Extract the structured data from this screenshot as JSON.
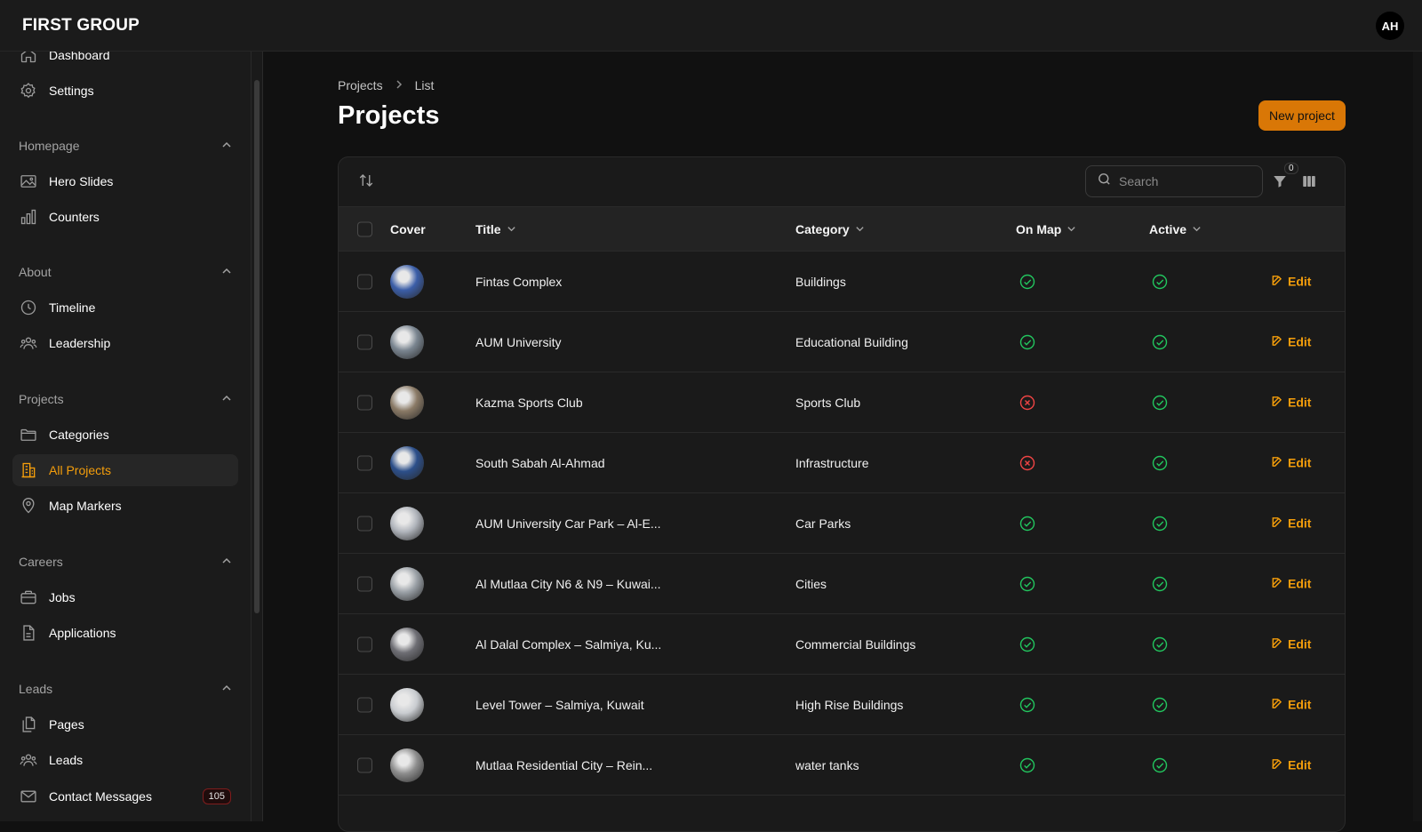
{
  "app": {
    "brand": "FIRST GROUP",
    "user_initials": "AH"
  },
  "sidebar": {
    "top_items": [
      {
        "label": "Dashboard",
        "icon": "home-icon"
      },
      {
        "label": "Settings",
        "icon": "gear-icon"
      }
    ],
    "groups": [
      {
        "label": "Homepage",
        "items": [
          {
            "label": "Hero Slides",
            "icon": "image-icon"
          },
          {
            "label": "Counters",
            "icon": "bar-chart-icon"
          }
        ]
      },
      {
        "label": "About",
        "items": [
          {
            "label": "Timeline",
            "icon": "clock-icon"
          },
          {
            "label": "Leadership",
            "icon": "users-icon"
          }
        ]
      },
      {
        "label": "Projects",
        "items": [
          {
            "label": "Categories",
            "icon": "folder-icon"
          },
          {
            "label": "All Projects",
            "icon": "building-icon",
            "active": true
          },
          {
            "label": "Map Markers",
            "icon": "map-pin-icon"
          }
        ]
      },
      {
        "label": "Careers",
        "items": [
          {
            "label": "Jobs",
            "icon": "briefcase-icon"
          },
          {
            "label": "Applications",
            "icon": "document-icon"
          }
        ]
      },
      {
        "label": "Leads",
        "items": [
          {
            "label": "Pages",
            "icon": "pages-icon"
          },
          {
            "label": "Leads",
            "icon": "users-icon"
          },
          {
            "label": "Contact Messages",
            "icon": "mail-icon",
            "badge": "105"
          }
        ]
      }
    ]
  },
  "breadcrumb": {
    "parent": "Projects",
    "current": "List"
  },
  "page": {
    "title": "Projects",
    "new_button": "New project"
  },
  "toolbar": {
    "search_placeholder": "Search",
    "filter_count": "0"
  },
  "table": {
    "columns": {
      "cover": "Cover",
      "title": "Title",
      "category": "Category",
      "on_map": "On Map",
      "active": "Active"
    },
    "edit_label": "Edit",
    "rows": [
      {
        "title": "Fintas Complex",
        "category": "Buildings",
        "on_map": true,
        "active": true,
        "thumb_color": "#3b5ea8"
      },
      {
        "title": "AUM University",
        "category": "Educational Building",
        "on_map": true,
        "active": true,
        "thumb_color": "#7a8590"
      },
      {
        "title": "Kazma Sports Club",
        "category": "Sports Club",
        "on_map": false,
        "active": true,
        "thumb_color": "#8a7a66"
      },
      {
        "title": "South Sabah Al-Ahmad",
        "category": "Infrastructure",
        "on_map": false,
        "active": true,
        "thumb_color": "#2c4f8a"
      },
      {
        "title": "AUM University Car Park – Al-E...",
        "category": "Car Parks",
        "on_map": true,
        "active": true,
        "thumb_color": "#b0b4bb"
      },
      {
        "title": "Al Mutlaa City N6 & N9 – Kuwai...",
        "category": "Cities",
        "on_map": true,
        "active": true,
        "thumb_color": "#9aa0a6"
      },
      {
        "title": "Al Dalal Complex – Salmiya, Ku...",
        "category": "Commercial Buildings",
        "on_map": true,
        "active": true,
        "thumb_color": "#6e6e74"
      },
      {
        "title": "Level Tower – Salmiya, Kuwait",
        "category": "High Rise Buildings",
        "on_map": true,
        "active": true,
        "thumb_color": "#c9ccd0"
      },
      {
        "title": "Mutlaa Residential City – Rein...",
        "category": "water tanks",
        "on_map": true,
        "active": true,
        "thumb_color": "#8d8d8d"
      }
    ]
  },
  "colors": {
    "accent": "#f59e0b",
    "success": "#22c55e",
    "danger": "#ef4444"
  }
}
